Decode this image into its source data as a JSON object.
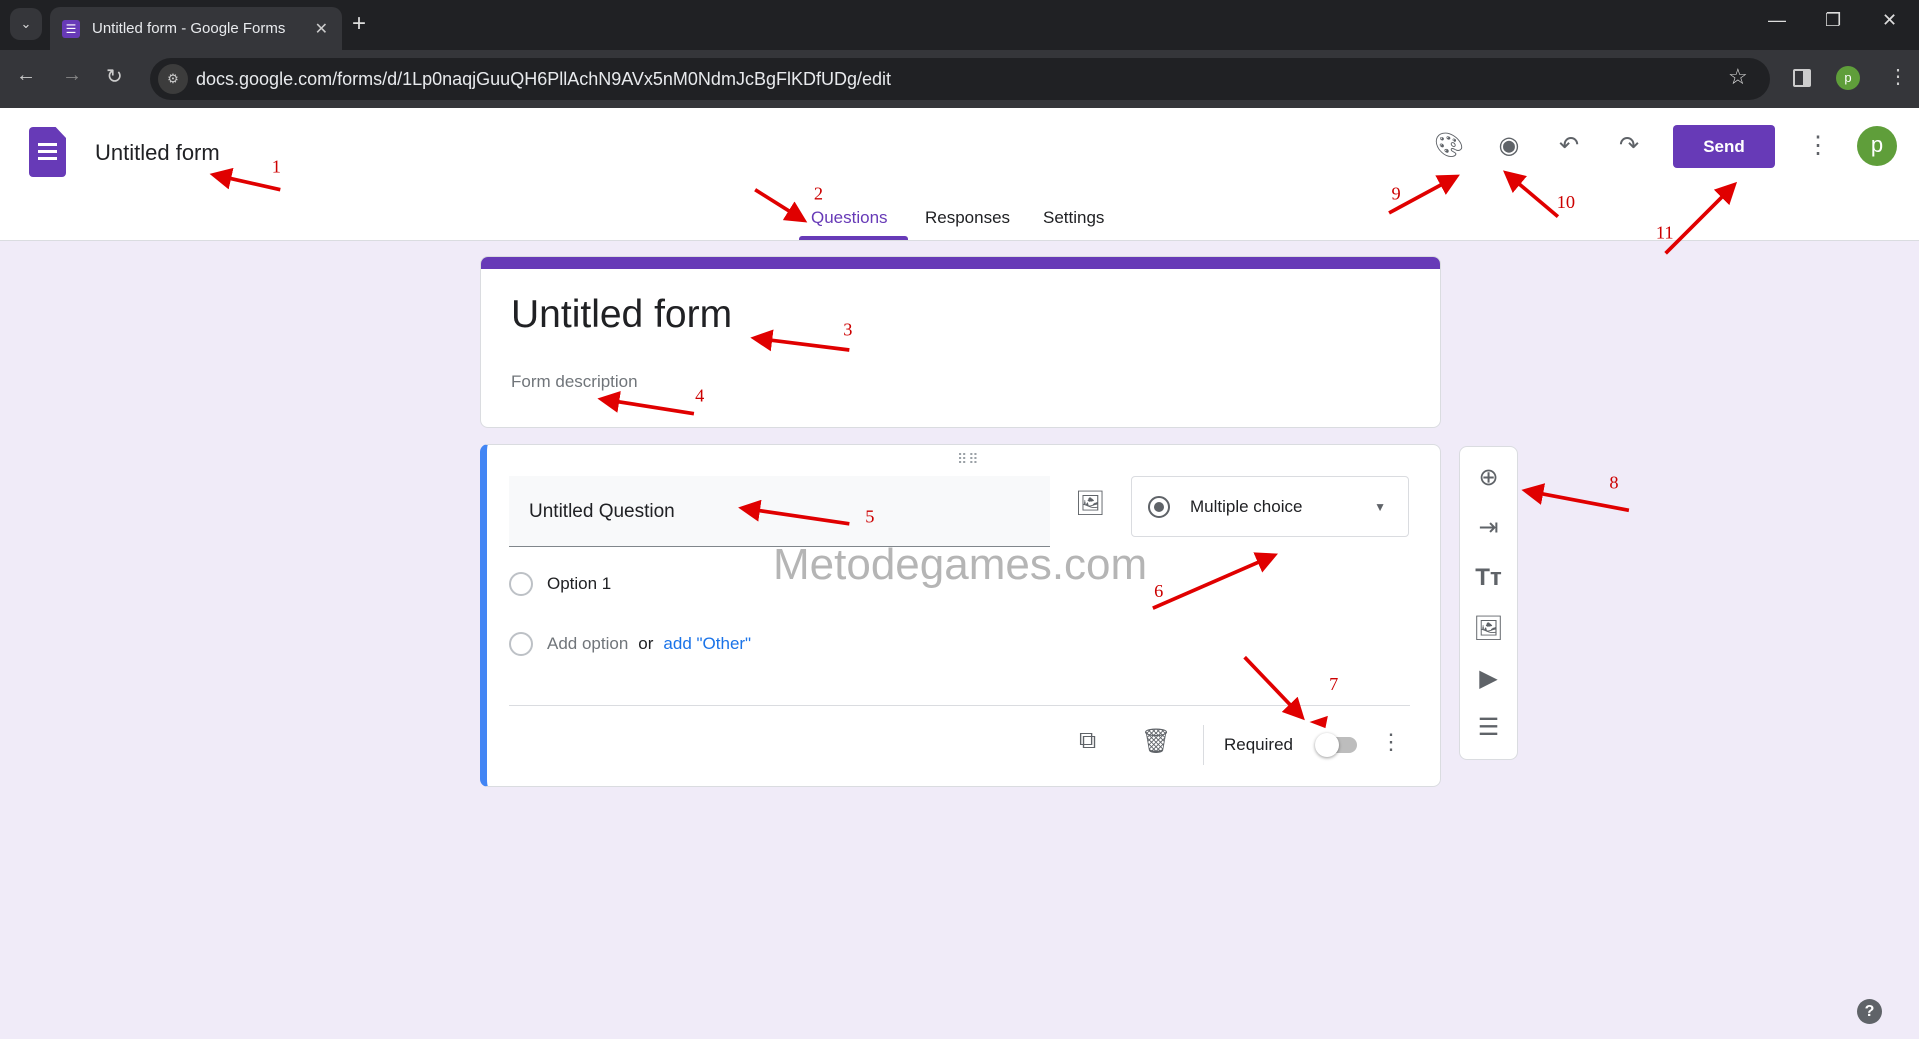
{
  "browser": {
    "tab_title": "Untitled form - Google Forms",
    "url": "docs.google.com/forms/d/1Lp0naqjGuuQH6PllAchN9AVx5nM0NdmJcBgFlKDfUDg/edit",
    "profile_initial": "p"
  },
  "header": {
    "doc_title": "Untitled form",
    "tabs": [
      {
        "label": "Questions",
        "active": true
      },
      {
        "label": "Responses"
      },
      {
        "label": "Settings"
      }
    ],
    "icons": [
      "palette-icon",
      "eye-icon",
      "undo-icon",
      "redo-icon"
    ],
    "send_label": "Send",
    "avatar_initial": "p"
  },
  "form": {
    "title": "Untitled form",
    "description_placeholder": "Form description"
  },
  "question": {
    "title": "Untitled Question",
    "type": "Multiple choice",
    "options": [
      "Option 1"
    ],
    "add_option": "Add option",
    "or": "or",
    "add_other": "add \"Other\"",
    "required_label": "Required",
    "required": false
  },
  "sidebar": {
    "icons": [
      "add-question-icon",
      "import-questions-icon",
      "add-title-icon",
      "add-image-icon",
      "add-video-icon",
      "add-section-icon"
    ]
  },
  "watermark": "Metodegames.com",
  "annotations": [
    "1",
    "2",
    "3",
    "4",
    "5",
    "6",
    "7",
    "8",
    "9",
    "10",
    "11"
  ],
  "colors": {
    "accent": "#673ab7",
    "background": "#f0ebf8",
    "active_question": "#4285f4",
    "annotation": "#e00000"
  }
}
